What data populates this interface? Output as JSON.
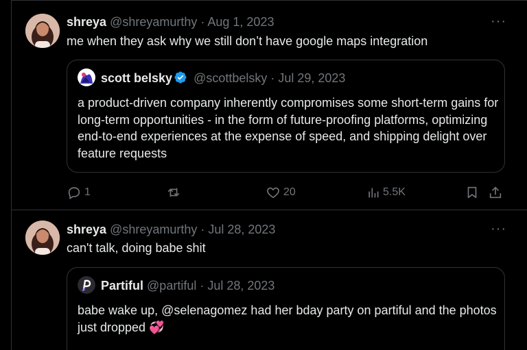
{
  "tweets": [
    {
      "author_name": "shreya",
      "handle_date": "@shreyamurthy · Aug 1, 2023",
      "text": "me when they ask why we still don’t have google maps integration",
      "more": "···",
      "quote": {
        "author_name": "scott belsky",
        "verified": true,
        "handle_date": "@scottbelsky · Jul 29, 2023",
        "text": "a product-driven company inherently compromises some short-term gains for long-term opportunities - in the form of future-proofing platforms, optimizing end-to-end experiences at the expense of speed, and shipping delight over feature requests"
      },
      "actions": {
        "replies": "1",
        "retweets": "",
        "likes": "20",
        "views": "5.5K"
      }
    },
    {
      "author_name": "shreya",
      "handle_date": "@shreyamurthy · Jul 28, 2023",
      "text": "can't talk, doing babe shit",
      "more": "···",
      "quote": {
        "author_name": "Partiful",
        "handle_date": "@partiful · Jul 28, 2023",
        "text": "babe wake up, @selenagomez had her bday party on partiful and the photos just dropped 💞"
      }
    }
  ],
  "icons": {
    "reply": "reply-icon",
    "retweet": "retweet-icon",
    "like": "heart-icon",
    "views": "views-icon",
    "bookmark": "bookmark-icon",
    "share": "share-icon",
    "more": "more-icon",
    "verified": "verified-badge-icon"
  },
  "colors": {
    "background": "#000000",
    "text_primary": "#e7e9ea",
    "text_secondary": "#71767b",
    "border": "#2f3336",
    "verified": "#1d9bf0"
  }
}
